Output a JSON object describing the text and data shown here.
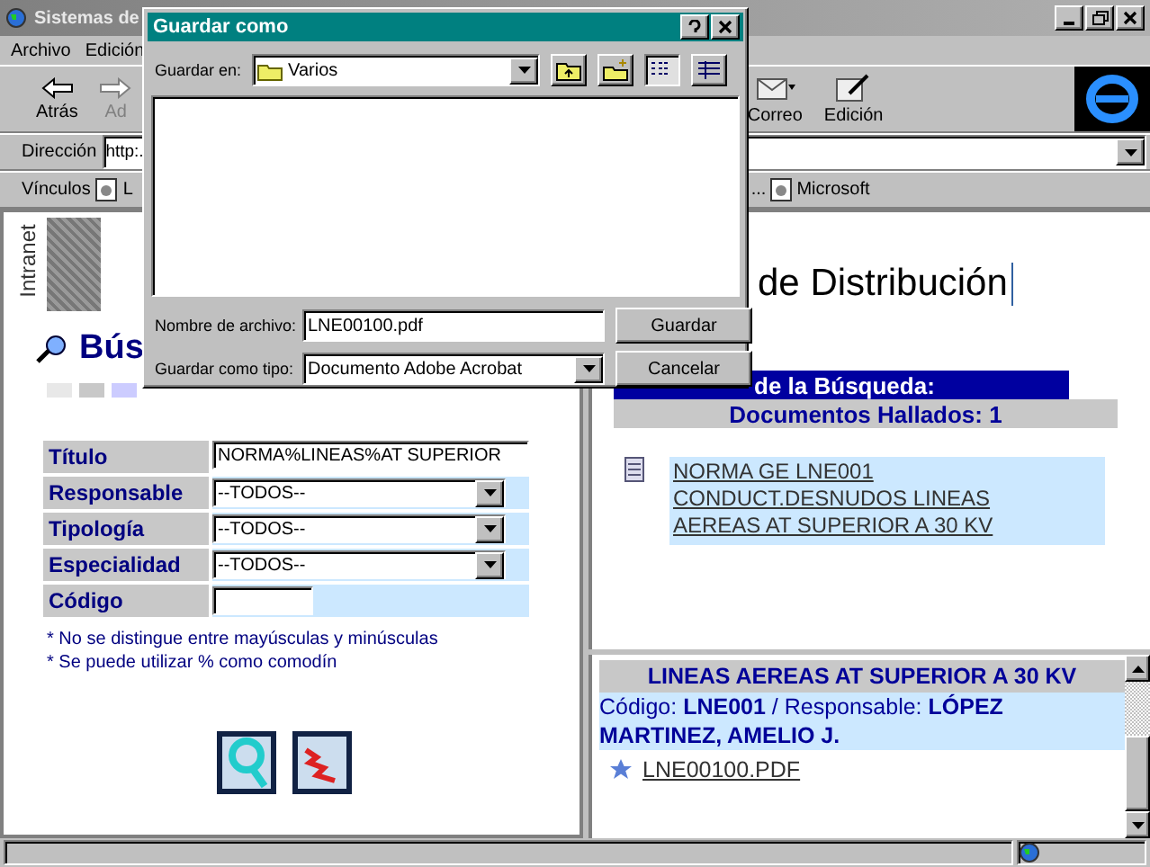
{
  "browser": {
    "title": "Sistemas de",
    "menu": [
      "Archivo",
      "Edición"
    ],
    "toolbar_left": [
      {
        "label": "Atrás",
        "disabled": false
      },
      {
        "label": "Ad",
        "disabled": true
      }
    ],
    "toolbar_right": [
      {
        "label": "Correo",
        "kind": "mail"
      },
      {
        "label": "Edición",
        "kind": "edit"
      }
    ],
    "address": {
      "label": "Dirección",
      "value": "http:."
    },
    "links": {
      "label": "Vínculos",
      "items": [
        {
          "label": "L",
          "kind": "page"
        },
        {
          "label": "...",
          "kind": "text"
        },
        {
          "label": "Microsoft",
          "kind": "page"
        }
      ]
    }
  },
  "left_frame": {
    "side_label": "Intranet",
    "heading": "Bús",
    "form": [
      {
        "label": "Título",
        "kind": "text",
        "value": "NORMA%LINEAS%AT SUPERIOR"
      },
      {
        "label": "Responsable",
        "kind": "select",
        "value": "--TODOS--"
      },
      {
        "label": "Tipología",
        "kind": "select",
        "value": "--TODOS--"
      },
      {
        "label": "Especialidad",
        "kind": "select",
        "value": "--TODOS--"
      },
      {
        "label": "Código",
        "kind": "short"
      }
    ],
    "notes": [
      "* No se distingue entre mayúsculas y minúsculas",
      "* Se puede utilizar % como comodín"
    ]
  },
  "right_frame": {
    "heading": "de Distribución",
    "results_title": "de la Búsqueda:",
    "results_count": "Documentos Hallados: 1",
    "results": [
      {
        "lines": [
          "NORMA GE LNE001",
          "CONDUCT.DESNUDOS LINEAS",
          "AEREAS AT SUPERIOR A 30 KV"
        ]
      }
    ]
  },
  "detail": {
    "title": "LINEAS AEREAS AT SUPERIOR A 30 KV",
    "info": "Código: **LNE001**  / Responsable: **LÓPEZ MARTINEZ, AMELIO J.**",
    "file": "LNE00100.PDF"
  },
  "dialog": {
    "title": "Guardar como",
    "save_in_label": "Guardar en:",
    "save_in": "Varios",
    "views": [
      {
        "kind": "list",
        "selected": true
      },
      {
        "kind": "details",
        "selected": false
      }
    ],
    "file_name_label": "Nombre de archivo:",
    "file_name": "LNE00100.pdf",
    "file_type_label": "Guardar como tipo:",
    "file_type": "Documento Adobe Acrobat",
    "buttons": [
      "Guardar",
      "Cancelar"
    ]
  }
}
